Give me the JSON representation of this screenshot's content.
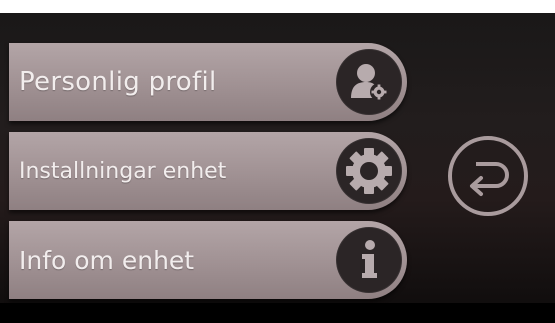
{
  "menu": {
    "items": [
      {
        "label": "Personlig profil",
        "icon": "user-settings-icon"
      },
      {
        "label": "Installningar enhet",
        "icon": "gear-icon"
      },
      {
        "label": "Info om enhet",
        "icon": "info-icon"
      }
    ]
  },
  "back_button": {
    "icon": "return-arrow-icon"
  },
  "colors": {
    "button_fill": "#a89a9c",
    "icon_circle": "#2b2526",
    "icon_glyph": "#b7abad",
    "label_text": "#f2eded",
    "background": "#1f1b1b"
  }
}
